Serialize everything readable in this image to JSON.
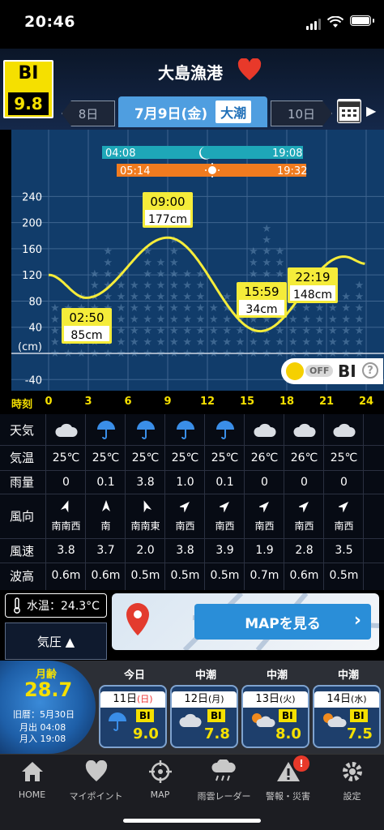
{
  "status": {
    "time": "20:46"
  },
  "header": {
    "bi_label": "BI",
    "bi_value": "9.8",
    "station": "大島漁港",
    "prev_day": "8日",
    "current_date": "7月9日(金)",
    "tide_type": "大潮",
    "next_day": "10日"
  },
  "chart": {
    "y_ticks": [
      "240",
      "200",
      "160",
      "120",
      "80",
      "40",
      "(cm)",
      "-40"
    ],
    "moon": {
      "rise": "04:08",
      "set": "19:08"
    },
    "sun": {
      "rise": "05:14",
      "set": "19:32"
    },
    "tides": [
      {
        "time": "02:50",
        "height": "85cm"
      },
      {
        "time": "09:00",
        "height": "177cm"
      },
      {
        "time": "15:59",
        "height": "34cm"
      },
      {
        "time": "22:19",
        "height": "148cm"
      }
    ],
    "toggle_state": "OFF",
    "toggle_label": "BI",
    "help": "?"
  },
  "chart_data": {
    "type": "line",
    "x": [
      0,
      2.83,
      9.0,
      15.98,
      22.32,
      24
    ],
    "values": [
      120,
      85,
      177,
      34,
      148,
      137
    ],
    "xlabel": "時刻",
    "ylabel": "(cm)",
    "x_ticks": [
      "0",
      "3",
      "6",
      "9",
      "12",
      "15",
      "18",
      "21",
      "24"
    ],
    "xlim": [
      0,
      24
    ],
    "ylim": [
      -60,
      260
    ],
    "line_color": "#f5ec3a"
  },
  "time_label": "時刻",
  "hours": [
    "0",
    "3",
    "6",
    "9",
    "12",
    "15",
    "18",
    "21",
    "24"
  ],
  "table": {
    "labels": [
      "天気",
      "気温",
      "雨量",
      "風向",
      "風速",
      "波高"
    ],
    "weather": [
      "cloud",
      "umbrella",
      "umbrella",
      "umbrella",
      "umbrella",
      "cloud",
      "cloud",
      "cloud"
    ],
    "temp": [
      "25℃",
      "25℃",
      "25℃",
      "25℃",
      "25℃",
      "26℃",
      "26℃",
      "25℃"
    ],
    "rain": [
      "0",
      "0.1",
      "3.8",
      "1.0",
      "0.1",
      "0",
      "0",
      "0"
    ],
    "wind_dir": [
      "南南西",
      "南",
      "南南東",
      "南西",
      "南西",
      "南西",
      "南西",
      "南西"
    ],
    "wind_speed": [
      "3.8",
      "3.7",
      "2.0",
      "3.8",
      "3.9",
      "1.9",
      "2.8",
      "3.5"
    ],
    "wave": [
      "0.6m",
      "0.6m",
      "0.5m",
      "0.5m",
      "0.5m",
      "0.7m",
      "0.6m",
      "0.5m"
    ]
  },
  "water": {
    "label": "水温：24.3°C"
  },
  "pressure": {
    "label": "気圧 ▲"
  },
  "map": {
    "label": "MAPを見る"
  },
  "moon": {
    "label": "月齢",
    "age": "28.7",
    "lunar": "旧暦：5月30日",
    "rise": "月出 04:08",
    "set": "月入 19:08"
  },
  "days": [
    {
      "header": "今日",
      "date": "11日",
      "dow": "(日)",
      "bi": "BI",
      "value": "9.0",
      "icon": "umbrella"
    },
    {
      "header": "中潮",
      "date": "12日",
      "dow": "(月)",
      "bi": "BI",
      "value": "7.8",
      "icon": "cloud"
    },
    {
      "header": "中潮",
      "date": "13日",
      "dow": "(火)",
      "bi": "BI",
      "value": "8.0",
      "icon": "sun-cloud"
    },
    {
      "header": "中潮",
      "date": "14日",
      "dow": "(水)",
      "bi": "BI",
      "value": "7.5",
      "icon": "sun-cloud"
    }
  ],
  "tabbar": {
    "items": [
      "HOME",
      "マイポイント",
      "MAP",
      "雨雲レーダー",
      "警報・災害",
      "設定"
    ],
    "badge": "!"
  },
  "colors": {
    "accent": "#f5e000",
    "chart_bg": "#113c6a",
    "tab_active": "#4f9ee0",
    "heart": "#e8392a"
  }
}
